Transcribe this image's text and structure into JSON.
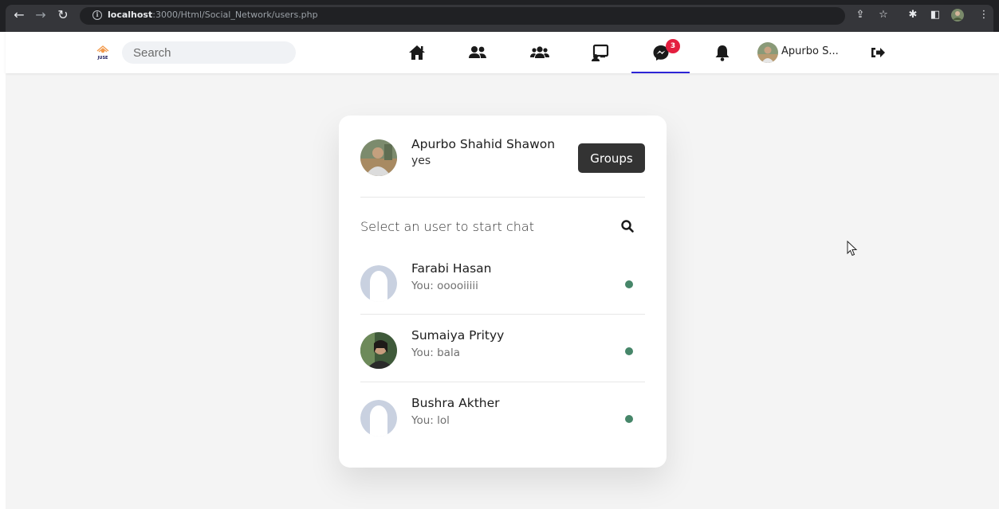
{
  "browser": {
    "url_host": "localhost",
    "url_path": ":3000/Html/Social_Network/users.php"
  },
  "topnav": {
    "search_placeholder": "Search",
    "messages_badge": "3",
    "user_short_name": "Apurbo S..."
  },
  "chat": {
    "me": {
      "name": "Apurbo Shahid Shawon",
      "status": "yes"
    },
    "groups_label": "Groups",
    "prompt": "Select an user to start chat",
    "users": [
      {
        "name": "Farabi Hasan",
        "last_message": "You: ooooiiiii",
        "online": true,
        "avatar": "default"
      },
      {
        "name": "Sumaiya Prityy",
        "last_message": "You: bala",
        "online": true,
        "avatar": "photo"
      },
      {
        "name": "Bushra Akther",
        "last_message": "You: lol",
        "online": true,
        "avatar": "default"
      }
    ]
  },
  "colors": {
    "active_tab": "#2c24d6",
    "badge": "#e41e3f",
    "online_dot": "#468669",
    "groups_button": "#333333"
  },
  "icons": [
    "home-icon",
    "friends-icon",
    "groups-icon",
    "watch-icon",
    "messenger-icon",
    "bell-icon",
    "logout-icon",
    "search-icon"
  ]
}
